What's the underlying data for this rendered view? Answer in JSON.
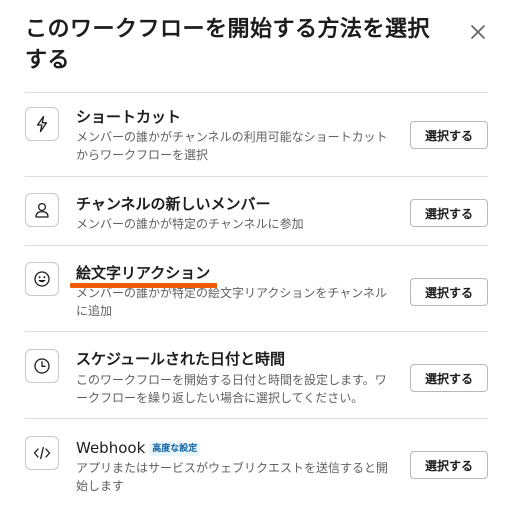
{
  "dialog": {
    "title": "このワークフローを開始する方法を選択する",
    "close_label": "×"
  },
  "colors": {
    "underline": "#f05a00",
    "badge_text": "#1264a3",
    "badge_bg": "#e8f5fa"
  },
  "options": [
    {
      "icon": "lightning-icon",
      "title": "ショートカット",
      "desc": "メンバーの誰かがチャンネルの利用可能なショートカットからワークフローを選択",
      "button": "選択する"
    },
    {
      "icon": "person-icon",
      "title": "チャンネルの新しいメンバー",
      "desc": "メンバーの誰かが特定のチャンネルに参加",
      "button": "選択する"
    },
    {
      "icon": "emoji-icon",
      "title": "絵文字リアクション",
      "desc": "メンバーの誰かが特定の絵文字リアクションをチャンネルに追加",
      "button": "選択する"
    },
    {
      "icon": "clock-icon",
      "title": "スケジュールされた日付と時間",
      "desc": "このワークフローを開始する日付と時間を設定します。ワークフローを繰り返したい場合に選択してください。",
      "button": "選択する"
    },
    {
      "icon": "code-icon",
      "title": "Webhook",
      "badge": "高度な設定",
      "desc": "アプリまたはサービスがウェブリクエストを送信すると開始します",
      "button": "選択する"
    }
  ]
}
